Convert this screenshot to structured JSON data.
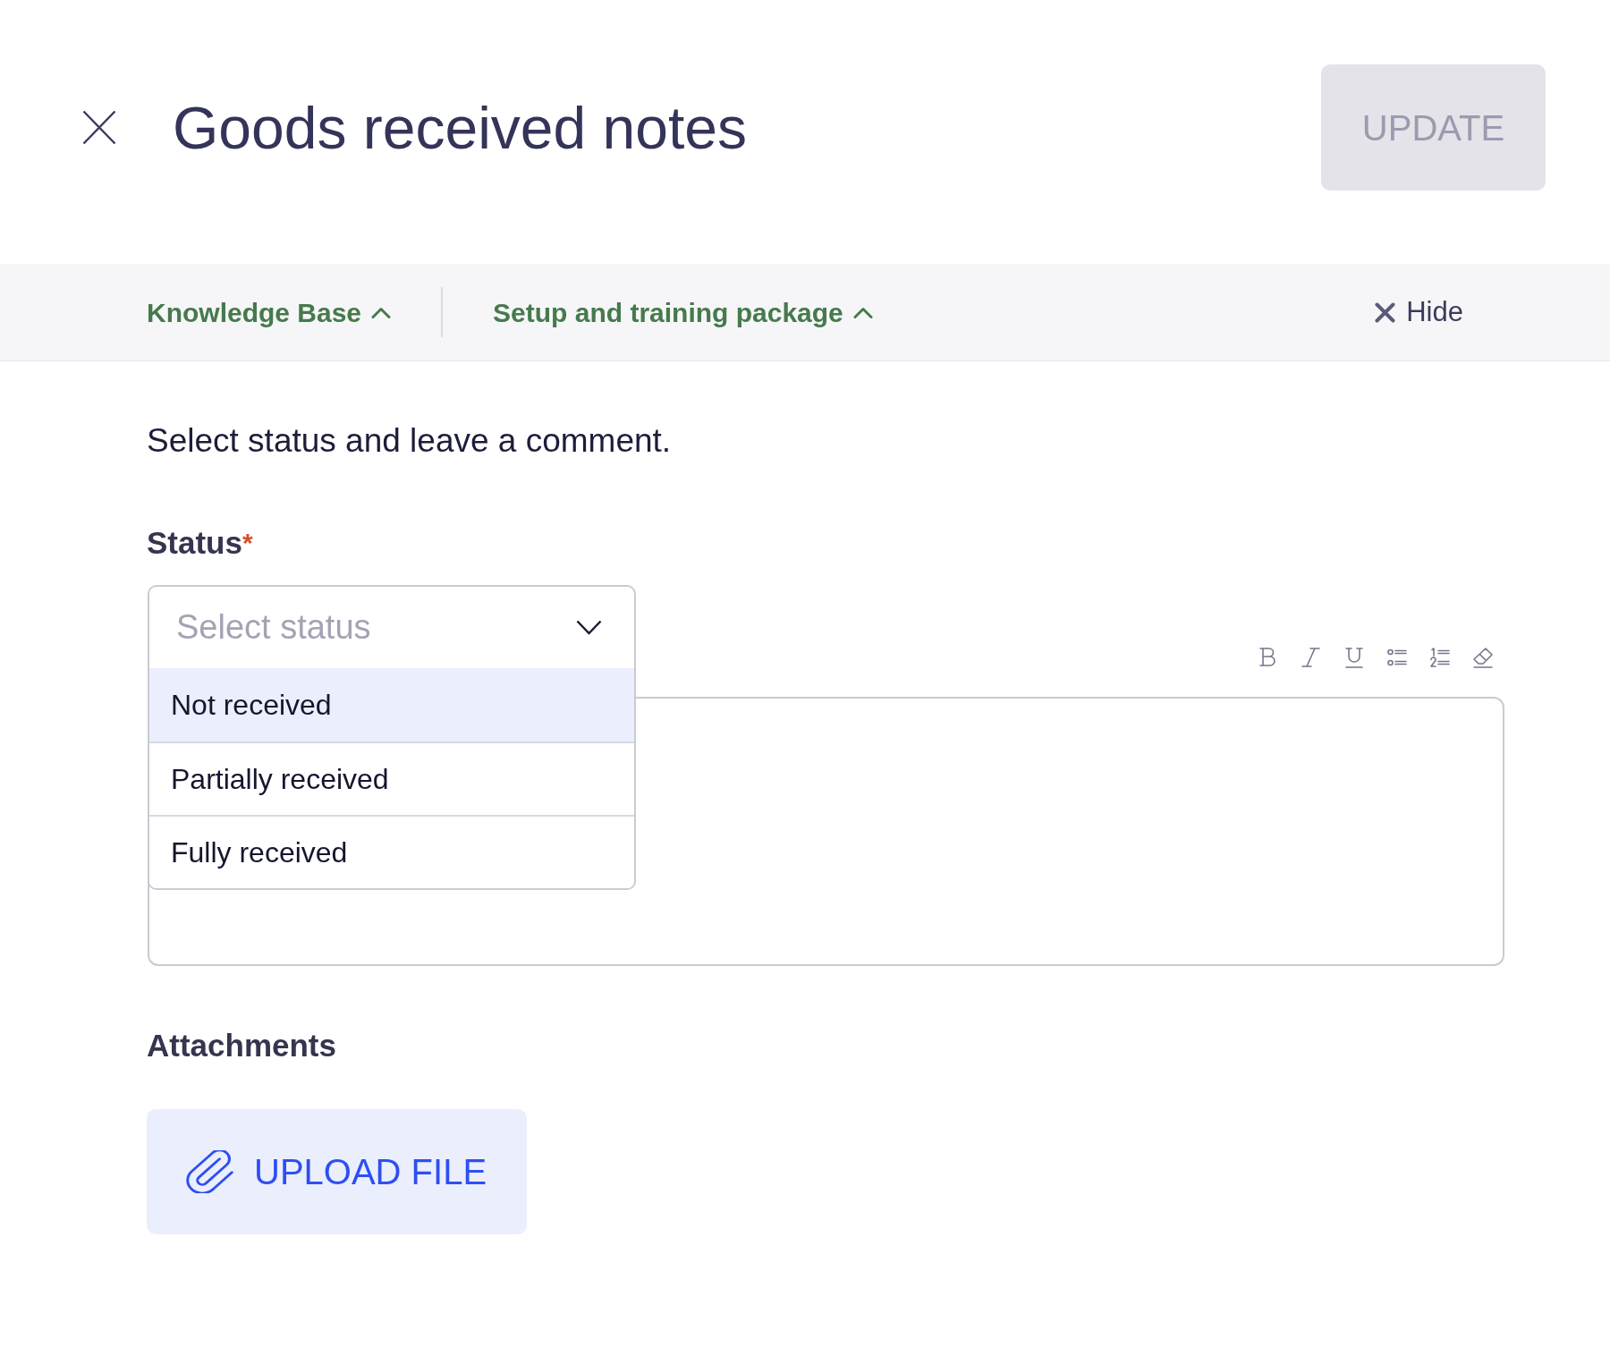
{
  "header": {
    "title": "Goods received notes",
    "update_button": {
      "label": "UPDATE",
      "disabled": true
    }
  },
  "nav_bar": {
    "links": [
      {
        "label": "Knowledge Base"
      },
      {
        "label": "Setup and training package"
      }
    ],
    "hide_button": {
      "label": "Hide"
    }
  },
  "form": {
    "instructions": "Select status and leave a comment.",
    "status": {
      "label": "Status",
      "required_mark": "*",
      "placeholder": "Select status",
      "open": true,
      "options": [
        {
          "label": "Not received",
          "highlighted": true
        },
        {
          "label": "Partially received",
          "highlighted": false
        },
        {
          "label": "Fully received",
          "highlighted": false
        }
      ]
    },
    "attachments": {
      "label": "Attachments",
      "upload_button": {
        "label": "UPLOAD FILE"
      }
    }
  }
}
